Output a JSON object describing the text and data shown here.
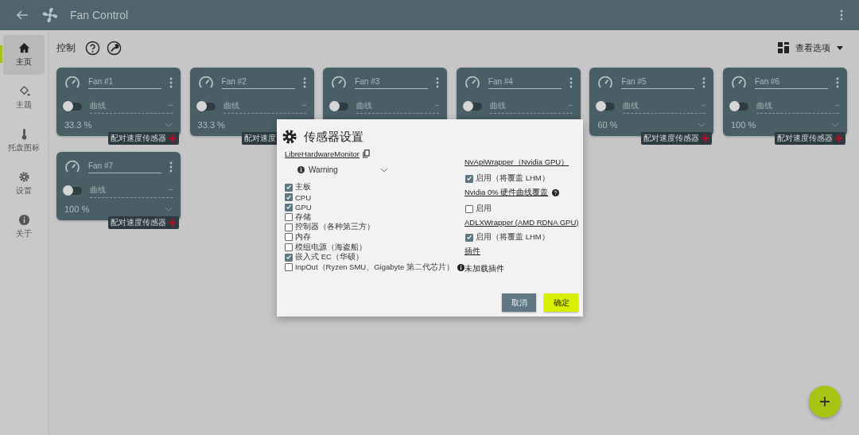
{
  "app_bar": {
    "title": "Fan Control"
  },
  "sidebar": {
    "items": [
      {
        "label": "主页",
        "selected": true
      },
      {
        "label": "主题",
        "selected": false
      },
      {
        "label": "托盘图标",
        "selected": false
      },
      {
        "label": "设置",
        "selected": false
      },
      {
        "label": "关于",
        "selected": false
      }
    ]
  },
  "section": {
    "title": "控制"
  },
  "view_options": {
    "label": "查看选项"
  },
  "fans": [
    {
      "name": "Fan #1",
      "on": false,
      "mode": "曲线",
      "percent": "33.3 %",
      "badge": "配对速度传感器"
    },
    {
      "name": "Fan #2",
      "on": false,
      "mode": "曲线",
      "percent": "33.3 %",
      "badge": "配对速度"
    },
    {
      "name": "Fan #3",
      "on": false,
      "mode": "曲线"
    },
    {
      "name": "Fan #4",
      "on": false,
      "mode": "曲线"
    },
    {
      "name": "Fan #5",
      "on": false,
      "mode": "曲线",
      "percent": "60 %",
      "badge": "配对速度传感器"
    },
    {
      "name": "Fan #6",
      "on": false,
      "mode": "曲线",
      "percent": "100 %",
      "badge": "配对速度传感器"
    },
    {
      "name": "Fan #7",
      "on": false,
      "mode": "曲线",
      "percent": "100 %",
      "badge": "配对速度传感器"
    }
  ],
  "dialog": {
    "title": "传感器设置",
    "source": {
      "title": "LibreHardwareMonitor",
      "log_level": "Warning",
      "sensors": [
        {
          "label": "主板",
          "checked": true,
          "info": false
        },
        {
          "label": "CPU",
          "checked": true,
          "info": false
        },
        {
          "label": "GPU",
          "checked": true,
          "info": false
        },
        {
          "label": "存储",
          "checked": false,
          "info": false
        },
        {
          "label": "控制器（各种第三方）",
          "checked": false,
          "info": false
        },
        {
          "label": "内存",
          "checked": false,
          "info": false
        },
        {
          "label": "模组电源（海盗船）",
          "checked": false,
          "info": false
        },
        {
          "label": "嵌入式 EC（华硕）",
          "checked": true,
          "info": false
        },
        {
          "label": "InpOut（Ryzen SMU、Gigabyte 第二代芯片）",
          "checked": false,
          "info": true
        }
      ]
    },
    "sections": [
      {
        "title": "NvApiWrapper（Nvidia GPU）",
        "help": false,
        "option": {
          "label": "启用（将覆盖 LHM）",
          "checked": true
        }
      },
      {
        "title": "Nvidia 0% 硬件曲线覆盖",
        "help": true,
        "option": {
          "label": "启用",
          "checked": false
        }
      },
      {
        "title": "ADLXWrapper (AMD RDNA GPU)",
        "help": false,
        "option": {
          "label": "启用（将覆盖 LHM）",
          "checked": true
        }
      },
      {
        "title": "插件",
        "help": false,
        "note": "未加载插件"
      }
    ],
    "buttons": [
      {
        "label": "取消",
        "kind": "cancel"
      },
      {
        "label": "确定",
        "kind": "confirm"
      }
    ]
  }
}
